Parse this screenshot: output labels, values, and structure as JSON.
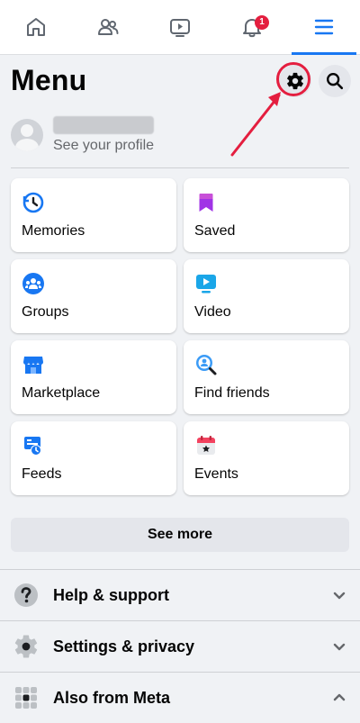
{
  "nav": {
    "tabs": [
      {
        "name": "home",
        "icon": "home-icon",
        "active": false
      },
      {
        "name": "friends",
        "icon": "friends-icon",
        "active": false
      },
      {
        "name": "video",
        "icon": "video-icon",
        "active": false
      },
      {
        "name": "notifications",
        "icon": "bell-icon",
        "active": false,
        "badge": "1"
      },
      {
        "name": "menu",
        "icon": "menu-icon",
        "active": true
      }
    ]
  },
  "header": {
    "title": "Menu",
    "settings_icon": "gear-icon",
    "search_icon": "search-icon"
  },
  "profile": {
    "subtitle": "See your profile"
  },
  "shortcuts": [
    {
      "label": "Memories",
      "icon": "memories-icon"
    },
    {
      "label": "Saved",
      "icon": "saved-icon"
    },
    {
      "label": "Groups",
      "icon": "groups-icon"
    },
    {
      "label": "Video",
      "icon": "video-icon"
    },
    {
      "label": "Marketplace",
      "icon": "marketplace-icon"
    },
    {
      "label": "Find friends",
      "icon": "find-friends-icon"
    },
    {
      "label": "Feeds",
      "icon": "feeds-icon"
    },
    {
      "label": "Events",
      "icon": "events-icon"
    }
  ],
  "see_more": "See more",
  "sections": [
    {
      "label": "Help & support",
      "icon": "help-icon",
      "expanded": false
    },
    {
      "label": "Settings & privacy",
      "icon": "settings-icon",
      "expanded": false
    },
    {
      "label": "Also from Meta",
      "icon": "apps-grid-icon",
      "expanded": true
    }
  ],
  "colors": {
    "accent": "#1877f2",
    "badge": "#e41e3f",
    "annotation": "#e41e3f",
    "background": "#f0f2f5"
  }
}
